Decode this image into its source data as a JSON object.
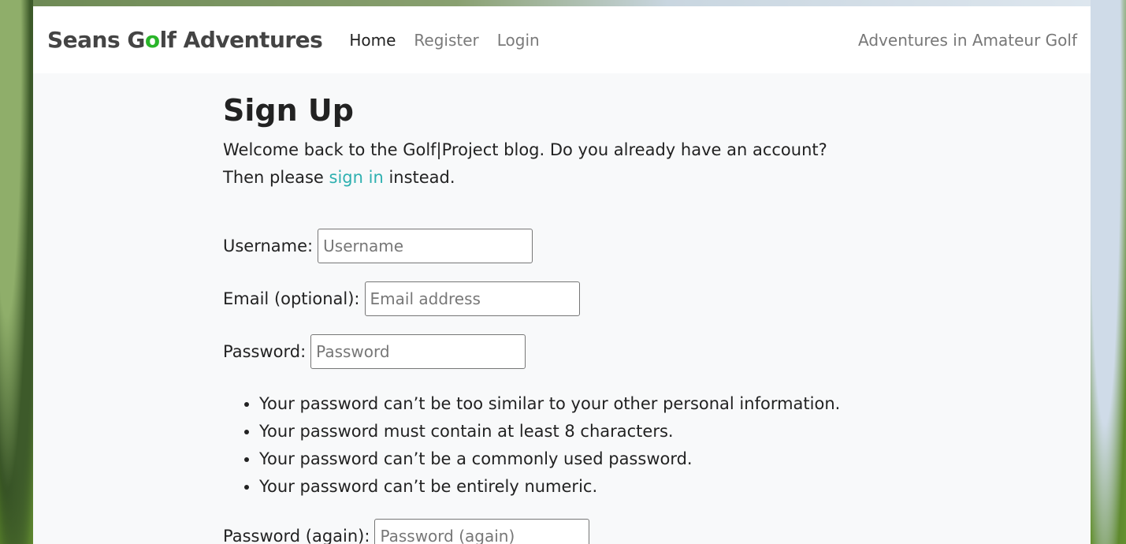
{
  "navbar": {
    "brand_part1": "Seans G",
    "brand_o": "o",
    "brand_part2": "lf Adventures",
    "links": [
      {
        "label": "Home",
        "active": true
      },
      {
        "label": "Register",
        "active": false
      },
      {
        "label": "Login",
        "active": false
      }
    ],
    "tagline": "Adventures in Amateur Golf"
  },
  "page": {
    "title": "Sign Up",
    "intro_before": "Welcome back to the Golf|Project blog. Do you already have an account? Then please ",
    "intro_link": "sign in",
    "intro_after": " instead."
  },
  "form": {
    "username": {
      "label": "Username:",
      "placeholder": "Username",
      "value": ""
    },
    "email": {
      "label": "Email (optional):",
      "placeholder": "Email address",
      "value": ""
    },
    "password": {
      "label": "Password:",
      "placeholder": "Password",
      "value": ""
    },
    "password_help": [
      "Your password can’t be too similar to your other personal information.",
      "Your password must contain at least 8 characters.",
      "Your password can’t be a commonly used password.",
      "Your password can’t be entirely numeric."
    ],
    "password2": {
      "label": "Password (again):",
      "placeholder": "Password (again)",
      "value": ""
    }
  },
  "colors": {
    "brand_o": "#2ab52a",
    "link": "#2eb0b0",
    "main_bg": "#f8f9fa",
    "nav_bg": "#ffffff"
  }
}
